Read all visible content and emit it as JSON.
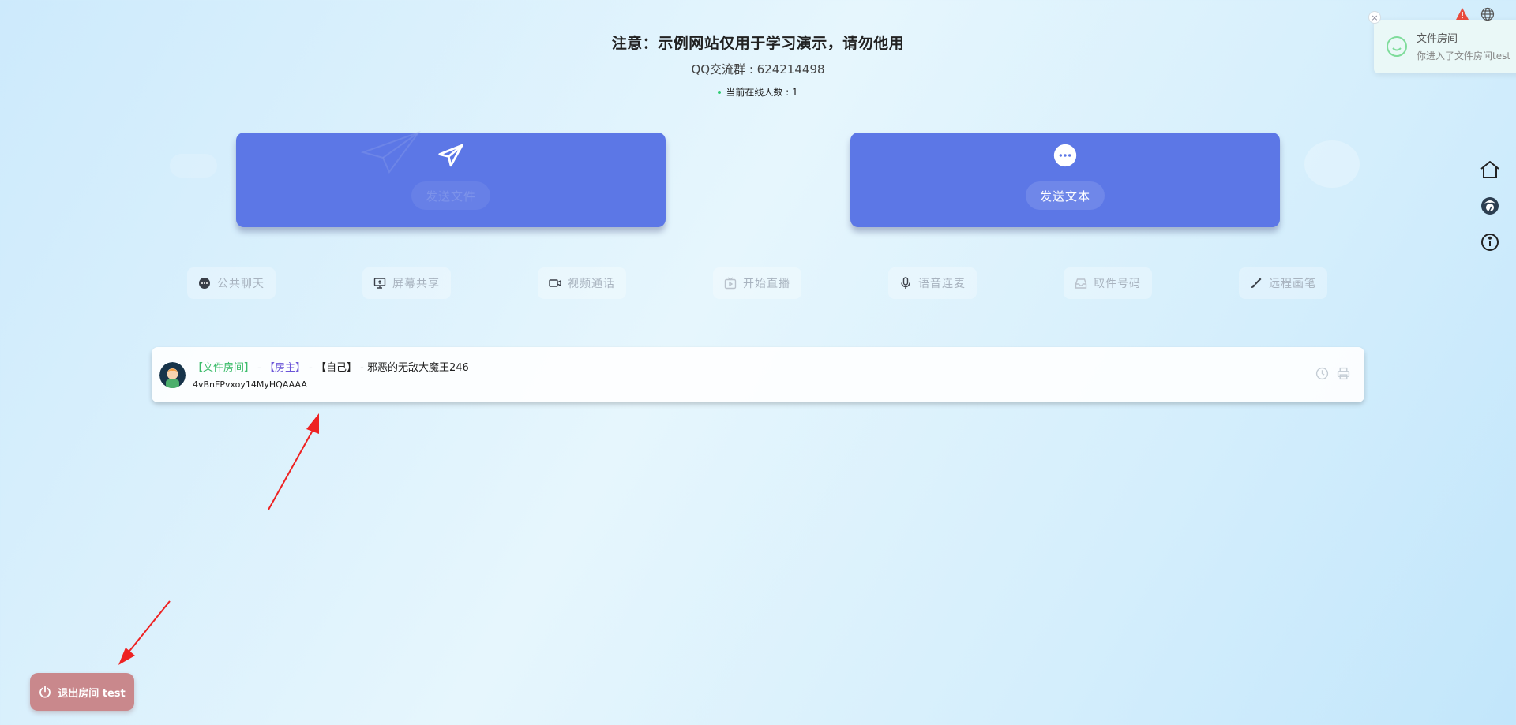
{
  "header": {
    "notice": "注意：示例网站仅用于学习演示，请勿他用",
    "qq": "QQ交流群 : 624214498",
    "online": "当前在线人数 : 1"
  },
  "cards": {
    "file_label": "发送文件",
    "text_label": "发送文本"
  },
  "tools": [
    {
      "label": "公共聊天",
      "icon": "chat-bubble-icon"
    },
    {
      "label": "屏幕共享",
      "icon": "screen-share-icon"
    },
    {
      "label": "视频通话",
      "icon": "video-camera-icon"
    },
    {
      "label": "开始直播",
      "icon": "tv-live-icon"
    },
    {
      "label": "语音连麦",
      "icon": "microphone-icon"
    },
    {
      "label": "取件号码",
      "icon": "inbox-icon"
    },
    {
      "label": "远程画笔",
      "icon": "brush-icon"
    }
  ],
  "room_row": {
    "tag_room": "【文件房间】",
    "tag_host": "【房主】",
    "tag_self": "【自己】",
    "sep": " - ",
    "username": "邪恶的无敌大魔王246",
    "room_id": "4vBnFPvxoy14MyHQAAAA"
  },
  "exit_button": {
    "label": "退出房间 test"
  },
  "toast": {
    "title": "文件房间",
    "message": "你进入了文件房间test",
    "close": "×"
  },
  "colors": {
    "card_blue": "#5c77e6",
    "exit_red": "#c9888c",
    "room_tag_green": "#3cbc6a",
    "host_tag_purple": "#6b55d8",
    "arrow_red": "#ee2222"
  }
}
